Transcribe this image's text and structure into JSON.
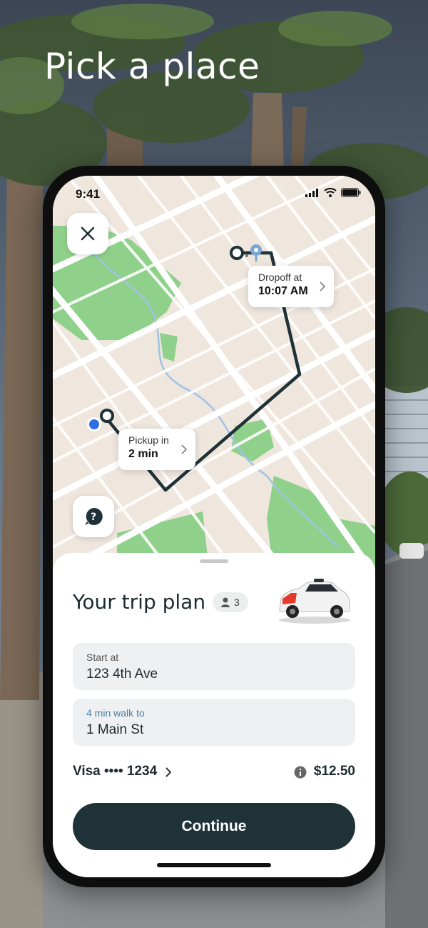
{
  "headline": "Pick a place",
  "status_bar": {
    "time": "9:41"
  },
  "map": {
    "close_icon": "close-icon",
    "help_icon": "help-icon",
    "dropoff": {
      "label": "Dropoff at",
      "time": "10:07 AM"
    },
    "pickup": {
      "label": "Pickup in",
      "eta": "2 min"
    }
  },
  "trip": {
    "title": "Your trip plan",
    "passengers": "3",
    "start": {
      "label": "Start at",
      "value": "123 4th Ave"
    },
    "destination": {
      "label": "4 min walk to",
      "value": "1 Main St"
    },
    "payment": {
      "card": "Visa •••• 1234",
      "price": "$12.50"
    },
    "continue_label": "Continue"
  },
  "colors": {
    "button": "#1f3238",
    "route": "#1f3238",
    "accent": "#4a7fa7",
    "park": "#8fd18b"
  }
}
